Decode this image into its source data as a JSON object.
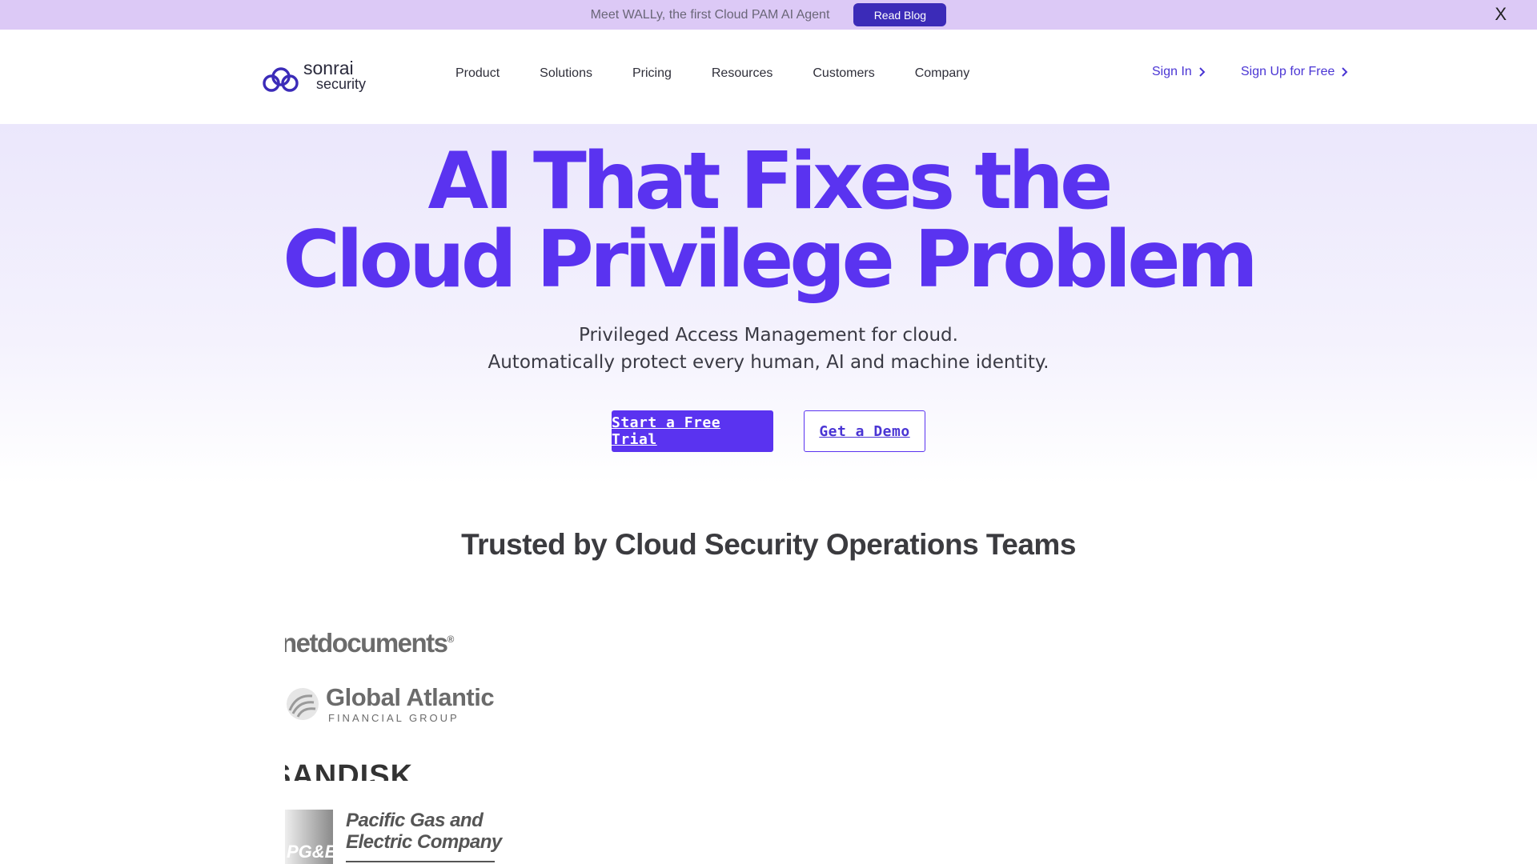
{
  "announcement": {
    "text": "Meet WALLy, the first Cloud PAM AI Agent",
    "button_label": "Read Blog",
    "close_label": "X"
  },
  "header": {
    "logo_line1": "sonrai",
    "logo_line2": "security",
    "nav": [
      "Product",
      "Solutions",
      "Pricing",
      "Resources",
      "Customers",
      "Company"
    ],
    "sign_in": "Sign In",
    "sign_up": "Sign Up for Free"
  },
  "hero": {
    "headline_line1": "AI That Fixes the",
    "headline_line2": "Cloud Privilege Problem",
    "subtitle_line1": "Privileged Access Management for cloud.",
    "subtitle_line2": "Automatically protect every human, AI and machine identity.",
    "primary_cta": "Start a Free Trial",
    "secondary_cta": "Get a Demo"
  },
  "trusted": {
    "heading": "Trusted by Cloud Security Operations Teams",
    "logos": {
      "netdocuments": "netdocuments",
      "global_atlantic": "Global Atlantic",
      "global_atlantic_sub": "FINANCIAL GROUP",
      "sandisk": "SANDISK",
      "pge_mark": "PG&E",
      "pge_line1": "Pacific Gas and",
      "pge_line2": "Electric Company"
    }
  },
  "colors": {
    "brand_purple": "#5a33f0",
    "announcement_bg": "#dcc9f6",
    "read_blog_bg": "#3b2bb8",
    "link_purple": "#4a35d4"
  }
}
